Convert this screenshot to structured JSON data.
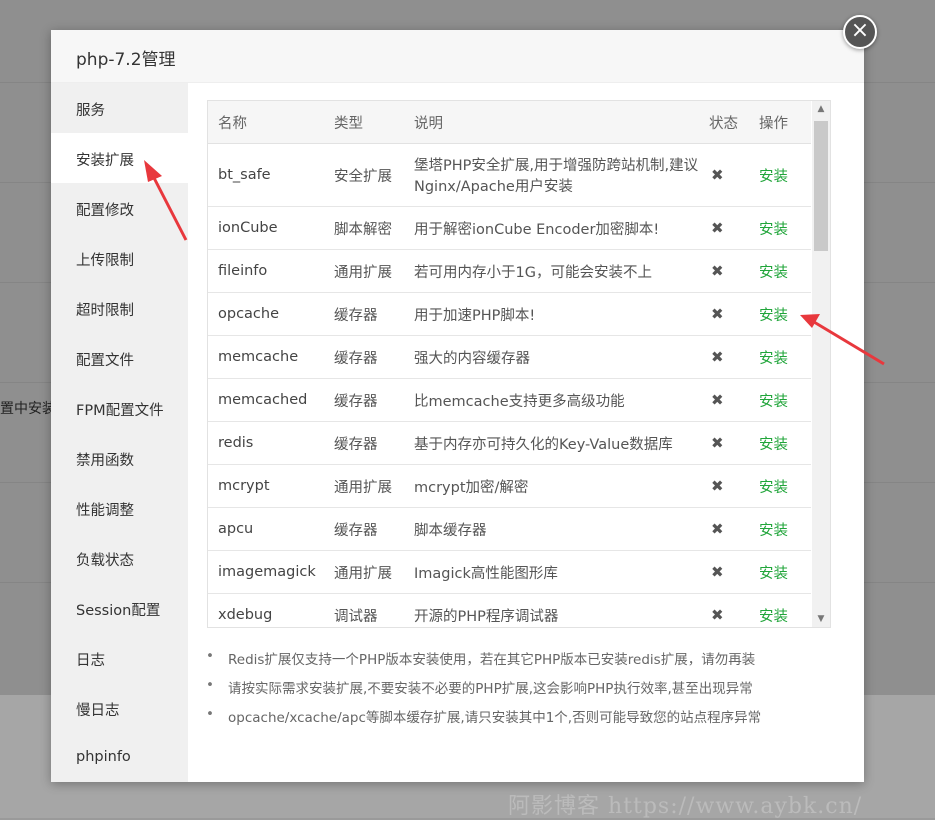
{
  "background": {
    "partial_text": "置中安装"
  },
  "modal": {
    "title": "php-7.2管理",
    "close_icon": "close-icon"
  },
  "sidebar": {
    "items": [
      {
        "label": "服务"
      },
      {
        "label": "安装扩展"
      },
      {
        "label": "配置修改"
      },
      {
        "label": "上传限制"
      },
      {
        "label": "超时限制"
      },
      {
        "label": "配置文件"
      },
      {
        "label": "FPM配置文件"
      },
      {
        "label": "禁用函数"
      },
      {
        "label": "性能调整"
      },
      {
        "label": "负载状态"
      },
      {
        "label": "Session配置"
      },
      {
        "label": "日志"
      },
      {
        "label": "慢日志"
      },
      {
        "label": "phpinfo"
      }
    ],
    "active": "安装扩展"
  },
  "table": {
    "headers": [
      "名称",
      "类型",
      "说明",
      "状态",
      "操作"
    ],
    "rows": [
      {
        "name": "bt_safe",
        "type": "安全扩展",
        "desc": "堡塔PHP安全扩展,用于增强防跨站机制,建议Nginx/Apache用户安装",
        "status": "✖",
        "op": "安装"
      },
      {
        "name": "ionCube",
        "type": "脚本解密",
        "desc": "用于解密ionCube Encoder加密脚本!",
        "status": "✖",
        "op": "安装"
      },
      {
        "name": "fileinfo",
        "type": "通用扩展",
        "desc": "若可用内存小于1G，可能会安装不上",
        "status": "✖",
        "op": "安装"
      },
      {
        "name": "opcache",
        "type": "缓存器",
        "desc": "用于加速PHP脚本!",
        "status": "✖",
        "op": "安装"
      },
      {
        "name": "memcache",
        "type": "缓存器",
        "desc": "强大的内容缓存器",
        "status": "✖",
        "op": "安装"
      },
      {
        "name": "memcached",
        "type": "缓存器",
        "desc": "比memcache支持更多高级功能",
        "status": "✖",
        "op": "安装"
      },
      {
        "name": "redis",
        "type": "缓存器",
        "desc": "基于内存亦可持久化的Key-Value数据库",
        "status": "✖",
        "op": "安装"
      },
      {
        "name": "mcrypt",
        "type": "通用扩展",
        "desc": "mcrypt加密/解密",
        "status": "✖",
        "op": "安装"
      },
      {
        "name": "apcu",
        "type": "缓存器",
        "desc": "脚本缓存器",
        "status": "✖",
        "op": "安装"
      },
      {
        "name": "imagemagick",
        "type": "通用扩展",
        "desc": "Imagick高性能图形库",
        "status": "✖",
        "op": "安装"
      },
      {
        "name": "xdebug",
        "type": "调试器",
        "desc": "开源的PHP程序调试器",
        "status": "✖",
        "op": "安装"
      }
    ]
  },
  "notes": [
    "Redis扩展仅支持一个PHP版本安装使用，若在其它PHP版本已安装redis扩展，请勿再装",
    "请按实际需求安装扩展,不要安装不必要的PHP扩展,这会影响PHP执行效率,甚至出现异常",
    "opcache/xcache/apc等脚本缓存扩展,请只安装其中1个,否则可能导致您的站点程序异常"
  ],
  "watermark": "阿影博客 https://www.aybk.cn/",
  "colors": {
    "accent_green": "#20a53a",
    "arrow_red": "#e8383d"
  }
}
